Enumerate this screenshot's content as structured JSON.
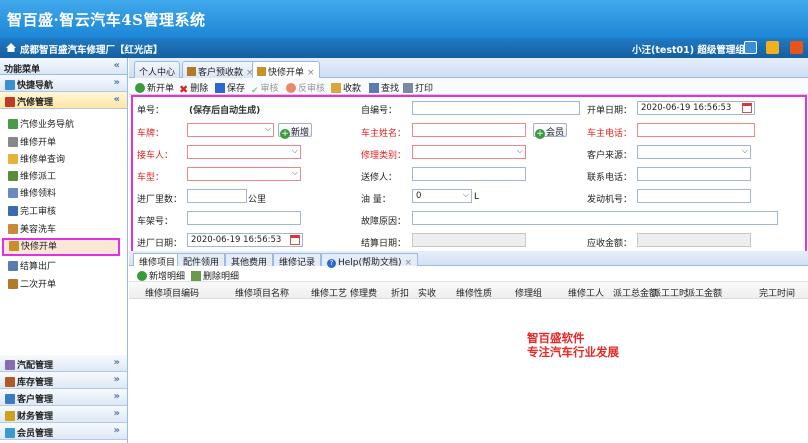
{
  "app": {
    "title": "智百盛·智云汽车4S管理系统"
  },
  "topbar": {
    "shop": "成都智百盛汽车修理厂【红光店】",
    "user": "小汪(test01) 超级管理组"
  },
  "sidebar": {
    "header": "功能菜单",
    "sections": [
      "快捷导航",
      "汽修管理"
    ],
    "items": [
      "汽修业务导航",
      "维修开单",
      "维修单查询",
      "维修派工",
      "维修领料",
      "完工审核",
      "美容洗车",
      "快修开单",
      "结算出厂",
      "二次开单"
    ],
    "bottom_sections": [
      "汽配管理",
      "库存管理",
      "客户管理",
      "财务管理",
      "会员管理"
    ]
  },
  "tabs": [
    "个人中心",
    "客户预收款",
    "快修开单"
  ],
  "toolbar": {
    "new": "新开单",
    "delete": "删除",
    "save": "保存",
    "audit": "审核",
    "unaudit": "反审核",
    "collect": "收款",
    "search": "查找",
    "print": "打印"
  },
  "form": {
    "order_no_label": "单号：",
    "order_no_value": "(保存后自动生成)",
    "self_no_label": "自编号：",
    "open_date_label": "开单日期：",
    "open_date_value": "2020-06-19 16:56:53",
    "plate_label": "车牌：",
    "new_btn": "新增",
    "owner_label": "车主姓名：",
    "member_btn": "会员",
    "owner_phone_label": "车主电话：",
    "receiver_label": "接车人：",
    "repair_type_label": "修理类别：",
    "source_label": "客户来源：",
    "model_label": "车型：",
    "sender_label": "送修人：",
    "contact_label": "联系电话：",
    "mileage_label": "进厂里数：",
    "mileage_unit": "公里",
    "oil_label": "油 量：",
    "oil_value": "0",
    "oil_unit": "L",
    "engine_label": "发动机号：",
    "vin_label": "车架号：",
    "fault_label": "故障原因：",
    "in_date_label": "进厂日期：",
    "in_date_value": "2020-06-19 16:56:53",
    "settle_date_label": "结算日期：",
    "receivable_label": "应收金额："
  },
  "subtabs": [
    "维修项目",
    "配件领用",
    "其他费用",
    "维修记录",
    "Help(帮助文档)"
  ],
  "subtool": {
    "add": "新增明细",
    "del": "删除明细"
  },
  "columns": [
    "维修项目编码",
    "维修项目名称",
    "维修工艺",
    "修理费",
    "折扣",
    "实收",
    "维修性质",
    "修理组",
    "维修工人",
    "派工总金额",
    "派工工时",
    "派工金额",
    "完工时间"
  ],
  "promo": {
    "line1": "智百盛软件",
    "line2": "专注汽车行业发展"
  },
  "colors": {
    "banner": "#2a95e0",
    "accent": "#e032e0",
    "required": "#e02020"
  }
}
